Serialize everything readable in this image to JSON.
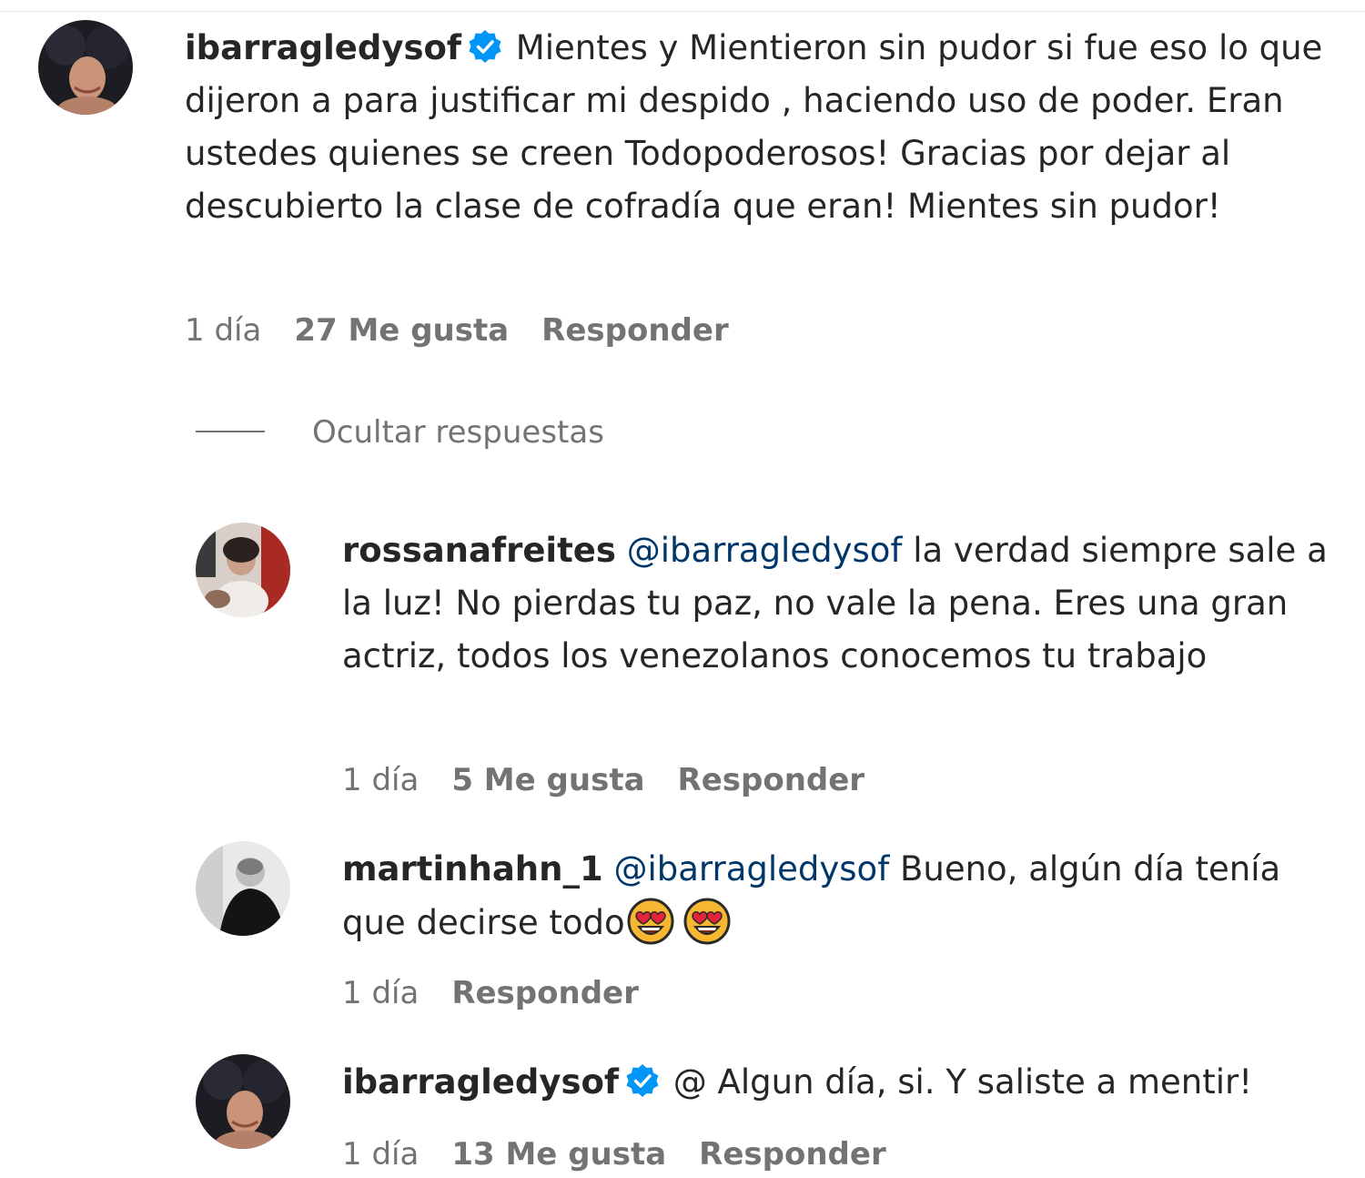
{
  "comments": [
    {
      "username": "ibarragledysof",
      "verified": true,
      "text": "Mientes y Mientieron sin pudor si fue eso lo que dijeron a para justificar mi despido , haciendo uso de poder. Eran ustedes quienes se creen Todopoderosos! Gracias por dejar al descubierto la clase de cofradía que eran! Mientes sin pudor!",
      "time": "1 día",
      "likes": "27 Me gusta",
      "reply": "Responder"
    }
  ],
  "hide_replies": "Ocultar respuestas",
  "replies": [
    {
      "username": "rossanafreites",
      "mention": "@ibarragledysof",
      "text": "la verdad siempre sale a la luz! No pierdas tu paz, no vale la pena. Eres una gran actriz, todos los venezolanos conocemos tu trabajo",
      "time": "1 día",
      "likes": "5 Me gusta",
      "reply": "Responder"
    },
    {
      "username": "martinhahn_1",
      "mention": "@ibarragledysof",
      "text": "Bueno, algún día tenía que decirse todo",
      "emoji": [
        "heart-eyes-emoji",
        "heart-eyes-emoji"
      ],
      "time": "1 día",
      "reply": "Responder"
    },
    {
      "username": "ibarragledysof",
      "verified": true,
      "text": "@ Algun día, si. Y saliste a mentir!",
      "time": "1 día",
      "likes": "13 Me gusta",
      "reply": "Responder"
    }
  ],
  "colors": {
    "text": "#262626",
    "secondary": "#737373",
    "mention": "#00376b",
    "verified": "#0095f6"
  }
}
